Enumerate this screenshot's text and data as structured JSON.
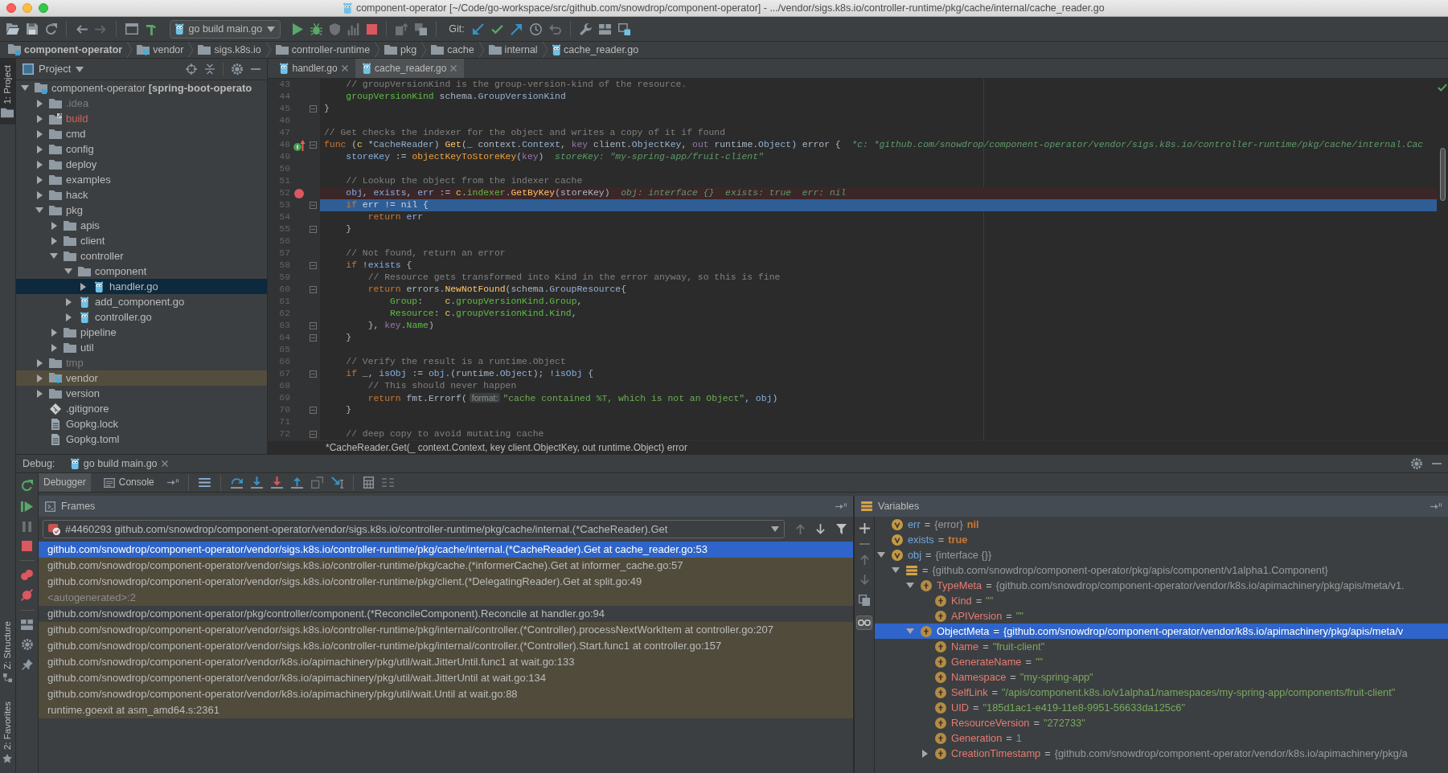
{
  "window": {
    "title": "component-operator [~/Code/go-workspace/src/github.com/snowdrop/component-operator] - .../vendor/sigs.k8s.io/controller-runtime/pkg/cache/internal/cache_reader.go"
  },
  "toolbar": {
    "run_config": "go build main.go",
    "git_label": "Git:"
  },
  "breadcrumbs": [
    {
      "label": "component-operator",
      "kind": "module"
    },
    {
      "label": "vendor",
      "kind": "folder-vendor"
    },
    {
      "label": "sigs.k8s.io",
      "kind": "folder"
    },
    {
      "label": "controller-runtime",
      "kind": "folder"
    },
    {
      "label": "pkg",
      "kind": "folder"
    },
    {
      "label": "cache",
      "kind": "folder"
    },
    {
      "label": "internal",
      "kind": "folder"
    },
    {
      "label": "cache_reader.go",
      "kind": "go-file"
    }
  ],
  "tool_windows": [
    {
      "label": "1: Project",
      "kind": "project",
      "selected": true
    },
    {
      "label": "Z: Structure",
      "kind": "structure",
      "selected": false
    },
    {
      "label": "2: Favorites",
      "kind": "favorites",
      "selected": false
    }
  ],
  "project": {
    "title": "Project",
    "tree": [
      {
        "label": "component-operator **[spring-boot-operato**",
        "kind": "module",
        "ignored": false,
        "unversioned": false,
        "library": false,
        "expanded": true,
        "selected": false,
        "children": [
          {
            "label": ".idea",
            "kind": "folder",
            "ignored": true,
            "unversioned": false,
            "library": false,
            "expanded": false,
            "selected": false
          },
          {
            "label": "build",
            "kind": "folder-link",
            "ignored": false,
            "unversioned": true,
            "library": false,
            "expanded": false,
            "selected": false
          },
          {
            "label": "cmd",
            "kind": "folder",
            "ignored": false,
            "unversioned": false,
            "library": false,
            "expanded": false,
            "selected": false
          },
          {
            "label": "config",
            "kind": "folder",
            "ignored": false,
            "unversioned": false,
            "library": false,
            "expanded": false,
            "selected": false
          },
          {
            "label": "deploy",
            "kind": "folder",
            "ignored": false,
            "unversioned": false,
            "library": false,
            "expanded": false,
            "selected": false
          },
          {
            "label": "examples",
            "kind": "folder",
            "ignored": false,
            "unversioned": false,
            "library": false,
            "expanded": false,
            "selected": false
          },
          {
            "label": "hack",
            "kind": "folder",
            "ignored": false,
            "unversioned": false,
            "library": false,
            "expanded": false,
            "selected": false
          },
          {
            "label": "pkg",
            "kind": "folder",
            "ignored": false,
            "unversioned": false,
            "library": false,
            "expanded": true,
            "selected": false,
            "children": [
              {
                "label": "apis",
                "kind": "folder",
                "ignored": false,
                "unversioned": false,
                "library": false,
                "expanded": false,
                "selected": false
              },
              {
                "label": "client",
                "kind": "folder",
                "ignored": false,
                "unversioned": false,
                "library": false,
                "expanded": false,
                "selected": false
              },
              {
                "label": "controller",
                "kind": "folder",
                "ignored": false,
                "unversioned": false,
                "library": false,
                "expanded": true,
                "selected": false,
                "children": [
                  {
                    "label": "component",
                    "kind": "folder",
                    "ignored": false,
                    "unversioned": false,
                    "library": false,
                    "expanded": true,
                    "selected": false,
                    "children": [
                      {
                        "label": "handler.go",
                        "kind": "go-file",
                        "ignored": false,
                        "unversioned": false,
                        "library": false,
                        "expanded": false,
                        "selected": true
                      }
                    ]
                  },
                  {
                    "label": "add_component.go",
                    "kind": "go-file",
                    "ignored": false,
                    "unversioned": false,
                    "library": false,
                    "expanded": false,
                    "selected": false
                  },
                  {
                    "label": "controller.go",
                    "kind": "go-file",
                    "ignored": false,
                    "unversioned": false,
                    "library": false,
                    "expanded": false,
                    "selected": false
                  }
                ]
              },
              {
                "label": "pipeline",
                "kind": "folder",
                "ignored": false,
                "unversioned": false,
                "library": false,
                "expanded": false,
                "selected": false
              },
              {
                "label": "util",
                "kind": "folder",
                "ignored": false,
                "unversioned": false,
                "library": false,
                "expanded": false,
                "selected": false
              }
            ]
          },
          {
            "label": "tmp",
            "kind": "folder",
            "ignored": true,
            "unversioned": false,
            "library": false,
            "expanded": false,
            "selected": false
          },
          {
            "label": "vendor",
            "kind": "folder-vendor",
            "ignored": false,
            "unversioned": false,
            "library": true,
            "expanded": false,
            "selected": false
          },
          {
            "label": "version",
            "kind": "folder",
            "ignored": false,
            "unversioned": false,
            "library": false,
            "expanded": false,
            "selected": false
          },
          {
            "label": ".gitignore",
            "kind": "git-file",
            "ignored": false,
            "unversioned": false,
            "library": false,
            "expanded": false,
            "selected": false
          },
          {
            "label": "Gopkg.lock",
            "kind": "text-file",
            "ignored": false,
            "unversioned": false,
            "library": false,
            "expanded": false,
            "selected": false
          },
          {
            "label": "Gopkg.toml",
            "kind": "text-file",
            "ignored": false,
            "unversioned": false,
            "library": false,
            "expanded": false,
            "selected": false
          }
        ]
      }
    ]
  },
  "editor": {
    "tabs": [
      {
        "label": "handler.go",
        "selected": false
      },
      {
        "label": "cache_reader.go",
        "selected": true
      }
    ],
    "lines": [
      {
        "n": "43",
        "kind": "code",
        "fold": false,
        "breakpoint": false,
        "current": false,
        "tokens": [
          {
            "kind": "comment",
            "text": "    // groupVersionKind is the group-version-kind of the resource."
          }
        ]
      },
      {
        "n": "44",
        "kind": "code",
        "fold": false,
        "breakpoint": false,
        "current": false,
        "tokens": [
          {
            "kind": "field",
            "text": "    groupVersionKind"
          },
          {
            "kind": "plain",
            "text": " schema."
          },
          {
            "kind": "type",
            "text": "GroupVersionKind"
          }
        ]
      },
      {
        "n": "45",
        "kind": "code",
        "fold": true,
        "breakpoint": false,
        "current": false,
        "tokens": [
          {
            "kind": "plain",
            "text": "}"
          }
        ]
      },
      {
        "n": "46",
        "kind": "code",
        "fold": false,
        "breakpoint": false,
        "current": false
      },
      {
        "n": "47",
        "kind": "code",
        "fold": false,
        "breakpoint": false,
        "current": false,
        "tokens": [
          {
            "kind": "comment",
            "text": "// Get checks the indexer for the object and writes a copy of it if found"
          }
        ]
      },
      {
        "n": "48",
        "kind": "method",
        "fold": true,
        "breakpoint": false,
        "current": false,
        "tokens": [
          {
            "kind": "kw",
            "text": "func"
          },
          {
            "kind": "plain",
            "text": " ("
          },
          {
            "kind": "recv",
            "text": "c"
          },
          {
            "kind": "plain",
            "text": " *"
          },
          {
            "kind": "type",
            "text": "CacheReader"
          },
          {
            "kind": "plain",
            "text": ") "
          },
          {
            "kind": "fn",
            "text": "Get"
          },
          {
            "kind": "plain",
            "text": "(_ context."
          },
          {
            "kind": "type",
            "text": "Context"
          },
          {
            "kind": "plain",
            "text": ", "
          },
          {
            "kind": "param",
            "text": "key"
          },
          {
            "kind": "plain",
            "text": " client."
          },
          {
            "kind": "type",
            "text": "ObjectKey"
          },
          {
            "kind": "plain",
            "text": ", "
          },
          {
            "kind": "param",
            "text": "out"
          },
          {
            "kind": "plain",
            "text": " runtime."
          },
          {
            "kind": "type",
            "text": "Object"
          },
          {
            "kind": "plain",
            "text": ") error {"
          },
          {
            "kind": "hint",
            "text": "*c: *github.com/snowdrop/component-operator/vendor/sigs.k8s.io/controller-runtime/pkg/cache/internal.Cac"
          }
        ]
      },
      {
        "n": "49",
        "kind": "code",
        "fold": false,
        "breakpoint": false,
        "current": false,
        "tokens": [
          {
            "kind": "local",
            "text": "    storeKey"
          },
          {
            "kind": "plain",
            "text": " := "
          },
          {
            "kind": "call",
            "text": "objectKeyToStoreKey"
          },
          {
            "kind": "plain",
            "text": "("
          },
          {
            "kind": "param",
            "text": "key"
          },
          {
            "kind": "plain",
            "text": ")"
          },
          {
            "kind": "hint",
            "text": "storeKey: \"my-spring-app/fruit-client\""
          }
        ]
      },
      {
        "n": "50",
        "kind": "code",
        "fold": false,
        "breakpoint": false,
        "current": false
      },
      {
        "n": "51",
        "kind": "code",
        "fold": false,
        "breakpoint": false,
        "current": false,
        "tokens": [
          {
            "kind": "comment",
            "text": "    // Lookup the object from the indexer cache"
          }
        ]
      },
      {
        "n": "52",
        "kind": "code",
        "fold": false,
        "breakpoint": true,
        "current": false,
        "tokens": [
          {
            "kind": "local",
            "text": "    obj"
          },
          {
            "kind": "plain",
            "text": ", "
          },
          {
            "kind": "local",
            "text": "exists"
          },
          {
            "kind": "plain",
            "text": ", "
          },
          {
            "kind": "local",
            "text": "err"
          },
          {
            "kind": "plain",
            "text": " := "
          },
          {
            "kind": "recv",
            "text": "c"
          },
          {
            "kind": "plain",
            "text": "."
          },
          {
            "kind": "field",
            "text": "indexer"
          },
          {
            "kind": "plain",
            "text": "."
          },
          {
            "kind": "fn",
            "text": "GetByKey"
          },
          {
            "kind": "plain",
            "text": "(storeKey)"
          },
          {
            "kind": "hint",
            "text": "obj: interface {}  exists: true  err: nil"
          }
        ]
      },
      {
        "n": "53",
        "kind": "code",
        "fold": true,
        "breakpoint": false,
        "current": true,
        "tokens": [
          {
            "kind": "kw",
            "text": "    if "
          },
          {
            "kind": "local",
            "text": "err"
          },
          {
            "kind": "plain",
            "text": " != nil {"
          }
        ]
      },
      {
        "n": "54",
        "kind": "code",
        "fold": false,
        "breakpoint": false,
        "current": false,
        "tokens": [
          {
            "kind": "kw",
            "text": "        return "
          },
          {
            "kind": "local",
            "text": "err"
          }
        ]
      },
      {
        "n": "55",
        "kind": "code",
        "fold": true,
        "breakpoint": false,
        "current": false,
        "tokens": [
          {
            "kind": "plain",
            "text": "    }"
          }
        ]
      },
      {
        "n": "56",
        "kind": "code",
        "fold": false,
        "breakpoint": false,
        "current": false
      },
      {
        "n": "57",
        "kind": "code",
        "fold": false,
        "breakpoint": false,
        "current": false,
        "tokens": [
          {
            "kind": "comment",
            "text": "    // Not found, return an error"
          }
        ]
      },
      {
        "n": "58",
        "kind": "code",
        "fold": true,
        "breakpoint": false,
        "current": false,
        "tokens": [
          {
            "kind": "kw",
            "text": "    if"
          },
          {
            "kind": "plain",
            "text": " !"
          },
          {
            "kind": "local",
            "text": "exists"
          },
          {
            "kind": "plain",
            "text": " {"
          }
        ]
      },
      {
        "n": "59",
        "kind": "code",
        "fold": false,
        "breakpoint": false,
        "current": false,
        "tokens": [
          {
            "kind": "comment",
            "text": "        // Resource gets transformed into Kind in the error anyway, so this is fine"
          }
        ]
      },
      {
        "n": "60",
        "kind": "code",
        "fold": true,
        "breakpoint": false,
        "current": false,
        "tokens": [
          {
            "kind": "kw",
            "text": "        return"
          },
          {
            "kind": "plain",
            "text": " errors."
          },
          {
            "kind": "fn",
            "text": "NewNotFound"
          },
          {
            "kind": "plain",
            "text": "(schema."
          },
          {
            "kind": "type",
            "text": "GroupResource"
          },
          {
            "kind": "plain",
            "text": "{"
          }
        ]
      },
      {
        "n": "61",
        "kind": "code",
        "fold": false,
        "breakpoint": false,
        "current": false,
        "tokens": [
          {
            "kind": "field",
            "text": "            Group"
          },
          {
            "kind": "plain",
            "text": ":    "
          },
          {
            "kind": "recv",
            "text": "c"
          },
          {
            "kind": "plain",
            "text": "."
          },
          {
            "kind": "field",
            "text": "groupVersionKind"
          },
          {
            "kind": "plain",
            "text": "."
          },
          {
            "kind": "field",
            "text": "Group"
          },
          {
            "kind": "plain",
            "text": ","
          }
        ]
      },
      {
        "n": "62",
        "kind": "code",
        "fold": false,
        "breakpoint": false,
        "current": false,
        "tokens": [
          {
            "kind": "field",
            "text": "            Resource"
          },
          {
            "kind": "plain",
            "text": ": "
          },
          {
            "kind": "recv",
            "text": "c"
          },
          {
            "kind": "plain",
            "text": "."
          },
          {
            "kind": "field",
            "text": "groupVersionKind"
          },
          {
            "kind": "plain",
            "text": "."
          },
          {
            "kind": "field",
            "text": "Kind"
          },
          {
            "kind": "plain",
            "text": ","
          }
        ]
      },
      {
        "n": "63",
        "kind": "code",
        "fold": true,
        "breakpoint": false,
        "current": false,
        "tokens": [
          {
            "kind": "plain",
            "text": "        }, "
          },
          {
            "kind": "param",
            "text": "key"
          },
          {
            "kind": "plain",
            "text": "."
          },
          {
            "kind": "field",
            "text": "Name"
          },
          {
            "kind": "plain",
            "text": ")"
          }
        ]
      },
      {
        "n": "64",
        "kind": "code",
        "fold": true,
        "breakpoint": false,
        "current": false,
        "tokens": [
          {
            "kind": "plain",
            "text": "    }"
          }
        ]
      },
      {
        "n": "65",
        "kind": "code",
        "fold": false,
        "breakpoint": false,
        "current": false
      },
      {
        "n": "66",
        "kind": "code",
        "fold": false,
        "breakpoint": false,
        "current": false,
        "tokens": [
          {
            "kind": "comment",
            "text": "    // Verify the result is a runtime.Object"
          }
        ]
      },
      {
        "n": "67",
        "kind": "code",
        "fold": true,
        "breakpoint": false,
        "current": false,
        "tokens": [
          {
            "kind": "kw",
            "text": "    if"
          },
          {
            "kind": "plain",
            "text": " _, "
          },
          {
            "kind": "local",
            "text": "isObj"
          },
          {
            "kind": "plain",
            "text": " := "
          },
          {
            "kind": "local",
            "text": "obj"
          },
          {
            "kind": "plain",
            "text": ".(runtime."
          },
          {
            "kind": "type",
            "text": "Object"
          },
          {
            "kind": "plain",
            "text": "); !"
          },
          {
            "kind": "local",
            "text": "isObj"
          },
          {
            "kind": "plain",
            "text": " {"
          }
        ]
      },
      {
        "n": "68",
        "kind": "code",
        "fold": false,
        "breakpoint": false,
        "current": false,
        "tokens": [
          {
            "kind": "comment",
            "text": "        // This should never happen"
          }
        ]
      },
      {
        "n": "69",
        "kind": "code",
        "fold": false,
        "breakpoint": false,
        "current": false,
        "tokens": [
          {
            "kind": "kw",
            "text": "        return"
          },
          {
            "kind": "plain",
            "text": " fmt.Errorf("
          },
          {
            "kind": "chip",
            "text": "format:"
          },
          {
            "kind": "str",
            "text": "\"cache contained %T, which is not an Object\""
          },
          {
            "kind": "plain",
            "text": ", "
          },
          {
            "kind": "local",
            "text": "obj"
          },
          {
            "kind": "plain",
            "text": ")"
          }
        ]
      },
      {
        "n": "70",
        "kind": "code",
        "fold": true,
        "breakpoint": false,
        "current": false,
        "tokens": [
          {
            "kind": "plain",
            "text": "    }"
          }
        ]
      },
      {
        "n": "71",
        "kind": "code",
        "fold": false,
        "breakpoint": false,
        "current": false
      },
      {
        "n": "72",
        "kind": "code",
        "fold": true,
        "breakpoint": false,
        "current": false,
        "tokens": [
          {
            "kind": "comment",
            "text": "    // deep copy to avoid mutating cache"
          }
        ]
      }
    ],
    "breadcrumb": "*CacheReader.Get(_ context.Context, key client.ObjectKey, out runtime.Object) error"
  },
  "debug": {
    "label": "Debug:",
    "session": "go build main.go",
    "tabs": [
      {
        "label": "Debugger",
        "kind": "debugger",
        "selected": true
      },
      {
        "label": "Console",
        "kind": "console",
        "selected": false
      }
    ],
    "frames": {
      "title": "Frames",
      "thread": "#4460293 github.com/snowdrop/component-operator/vendor/sigs.k8s.io/controller-runtime/pkg/cache/internal.(*CacheReader).Get",
      "items": [
        {
          "text": "github.com/snowdrop/component-operator/vendor/sigs.k8s.io/controller-runtime/pkg/cache/internal.(*CacheReader).Get at cache_reader.go:53",
          "kind": "library",
          "selected": true
        },
        {
          "text": "github.com/snowdrop/component-operator/vendor/sigs.k8s.io/controller-runtime/pkg/cache.(*informerCache).Get at informer_cache.go:57",
          "kind": "library",
          "selected": false
        },
        {
          "text": "github.com/snowdrop/component-operator/vendor/sigs.k8s.io/controller-runtime/pkg/client.(*DelegatingReader).Get at split.go:49",
          "kind": "library",
          "selected": false
        },
        {
          "text": "<autogenerated>:2",
          "kind": "generated",
          "selected": false
        },
        {
          "text": "github.com/snowdrop/component-operator/pkg/controller/component.(*ReconcileComponent).Reconcile at handler.go:94",
          "kind": "project",
          "selected": false
        },
        {
          "text": "github.com/snowdrop/component-operator/vendor/sigs.k8s.io/controller-runtime/pkg/internal/controller.(*Controller).processNextWorkItem at controller.go:207",
          "kind": "library",
          "selected": false
        },
        {
          "text": "github.com/snowdrop/component-operator/vendor/sigs.k8s.io/controller-runtime/pkg/internal/controller.(*Controller).Start.func1 at controller.go:157",
          "kind": "library",
          "selected": false
        },
        {
          "text": "github.com/snowdrop/component-operator/vendor/k8s.io/apimachinery/pkg/util/wait.JitterUntil.func1 at wait.go:133",
          "kind": "library",
          "selected": false
        },
        {
          "text": "github.com/snowdrop/component-operator/vendor/k8s.io/apimachinery/pkg/util/wait.JitterUntil at wait.go:134",
          "kind": "library",
          "selected": false
        },
        {
          "text": "github.com/snowdrop/component-operator/vendor/k8s.io/apimachinery/pkg/util/wait.Until at wait.go:88",
          "kind": "library",
          "selected": false
        },
        {
          "text": "runtime.goexit at asm_amd64.s:2361",
          "kind": "library",
          "selected": false
        }
      ]
    },
    "variables": {
      "title": "Variables",
      "items": [
        {
          "kind": "local",
          "name": "err",
          "op": "=",
          "type_name": "{error}",
          "value": {
            "text": "nil",
            "kind": "keyword"
          },
          "expanded": false,
          "selected": false
        },
        {
          "kind": "local",
          "name": "exists",
          "op": "=",
          "value": {
            "text": "true",
            "kind": "keyword"
          },
          "expanded": false,
          "selected": false
        },
        {
          "kind": "local",
          "name": "obj",
          "op": "=",
          "value": {
            "text": "{interface {}}",
            "kind": "object"
          },
          "expanded": true,
          "selected": false,
          "children": [
            {
              "kind": "struct",
              "op": "=",
              "value": {
                "text": "{github.com/snowdrop/component-operator/pkg/apis/component/v1alpha1.Component}",
                "kind": "object"
              },
              "expanded": true,
              "selected": false,
              "children": [
                {
                  "kind": "field",
                  "name": "TypeMeta",
                  "op": "=",
                  "value": {
                    "text": "{github.com/snowdrop/component-operator/vendor/k8s.io/apimachinery/pkg/apis/meta/v1.",
                    "kind": "object"
                  },
                  "expanded": true,
                  "selected": false,
                  "children": [
                    {
                      "kind": "field",
                      "name": "Kind",
                      "op": "=",
                      "value": {
                        "text": "\"\"",
                        "kind": "string"
                      },
                      "expanded": false,
                      "selected": false
                    },
                    {
                      "kind": "field",
                      "name": "APIVersion",
                      "op": "=",
                      "value": {
                        "text": "\"\"",
                        "kind": "string"
                      },
                      "expanded": false,
                      "selected": false
                    }
                  ]
                },
                {
                  "kind": "field",
                  "name": "ObjectMeta",
                  "op": "=",
                  "value": {
                    "text": "{github.com/snowdrop/component-operator/vendor/k8s.io/apimachinery/pkg/apis/meta/v",
                    "kind": "object"
                  },
                  "expanded": true,
                  "selected": true,
                  "children": [
                    {
                      "kind": "field",
                      "name": "Name",
                      "op": "=",
                      "value": {
                        "text": "\"fruit-client\"",
                        "kind": "string"
                      },
                      "expanded": false,
                      "selected": false
                    },
                    {
                      "kind": "field",
                      "name": "GenerateName",
                      "op": "=",
                      "value": {
                        "text": "\"\"",
                        "kind": "string"
                      },
                      "expanded": false,
                      "selected": false
                    },
                    {
                      "kind": "field",
                      "name": "Namespace",
                      "op": "=",
                      "value": {
                        "text": "\"my-spring-app\"",
                        "kind": "string"
                      },
                      "expanded": false,
                      "selected": false
                    },
                    {
                      "kind": "field",
                      "name": "SelfLink",
                      "op": "=",
                      "value": {
                        "text": "\"/apis/component.k8s.io/v1alpha1/namespaces/my-spring-app/components/fruit-client\"",
                        "kind": "string"
                      },
                      "expanded": false,
                      "selected": false
                    },
                    {
                      "kind": "field",
                      "name": "UID",
                      "op": "=",
                      "value": {
                        "text": "\"185d1ac1-e419-11e8-9951-56633da125c6\"",
                        "kind": "string"
                      },
                      "expanded": false,
                      "selected": false
                    },
                    {
                      "kind": "field",
                      "name": "ResourceVersion",
                      "op": "=",
                      "value": {
                        "text": "\"272733\"",
                        "kind": "string"
                      },
                      "expanded": false,
                      "selected": false
                    },
                    {
                      "kind": "field",
                      "name": "Generation",
                      "op": "=",
                      "value": {
                        "text": "1",
                        "kind": "number"
                      },
                      "expanded": false,
                      "selected": false
                    },
                    {
                      "kind": "field",
                      "name": "CreationTimestamp",
                      "op": "=",
                      "value": {
                        "text": "{github.com/snowdrop/component-operator/vendor/k8s.io/apimachinery/pkg/a",
                        "kind": "object"
                      },
                      "expanded": false,
                      "selected": false
                    }
                  ]
                }
              ]
            }
          ]
        }
      ]
    }
  }
}
